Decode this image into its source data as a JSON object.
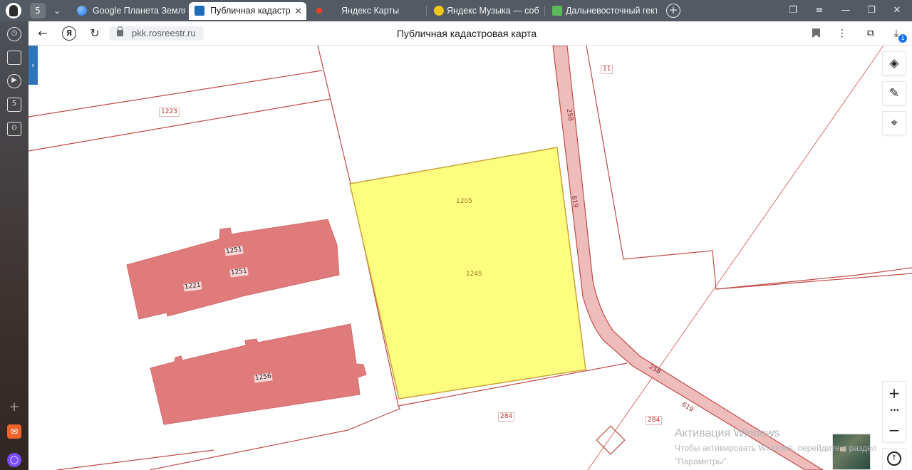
{
  "browser": {
    "tab_count": "5",
    "tabs": [
      {
        "label": "Google Планета Земля",
        "active": false,
        "icon": "globe-icon",
        "icon_color": "#4285f4"
      },
      {
        "label": "Публичная кадастровая карта",
        "active": true,
        "icon": "rosreestr-icon",
        "icon_color": "#1e6bb8"
      },
      {
        "label": "Яндекс Карты",
        "active": false,
        "icon": "pin-icon",
        "icon_color": "#fc3f1d"
      },
      {
        "label": "Яндекс Музыка — собираем музыку",
        "active": false,
        "icon": "sun-icon",
        "icon_color": "#f5c518"
      },
      {
        "label": "Дальневосточный гектар",
        "active": false,
        "icon": "dv-icon",
        "icon_color": "#5cb85c"
      }
    ],
    "address": {
      "domain": "pkk.rosreestr.ru",
      "title": "Публичная кадастровая карта",
      "downloads_badge": "1"
    }
  },
  "map": {
    "parcel_labels": [
      {
        "text": "11",
        "style": "boxed"
      },
      {
        "text": "1223",
        "style": "boxed"
      },
      {
        "text": "258",
        "style": "road"
      },
      {
        "text": "619",
        "style": "road"
      },
      {
        "text": "1205",
        "style": "plain"
      },
      {
        "text": "1245",
        "style": "plain"
      },
      {
        "text": "1251",
        "style": "building"
      },
      {
        "text": "1251",
        "style": "building"
      },
      {
        "text": "1221",
        "style": "building"
      },
      {
        "text": "1256",
        "style": "building"
      },
      {
        "text": "258",
        "style": "road"
      },
      {
        "text": "619",
        "style": "road"
      },
      {
        "text": "284",
        "style": "boxed"
      },
      {
        "text": "284",
        "style": "boxed"
      }
    ],
    "colors": {
      "selected_parcel": "#fdfd7f",
      "building": "#e07b7b",
      "road_fill": "#efbcbc",
      "boundary": "#c0392b"
    },
    "tools": [
      "layers-icon",
      "ruler-icon",
      "location-icon"
    ],
    "zoom": {
      "in": "+",
      "more": "•••",
      "out": "−"
    }
  },
  "watermark": {
    "title": "Активация Windows",
    "line1": "Чтобы активировать Windows, перейдите в раздел",
    "line2": "\"Параметры\"."
  }
}
